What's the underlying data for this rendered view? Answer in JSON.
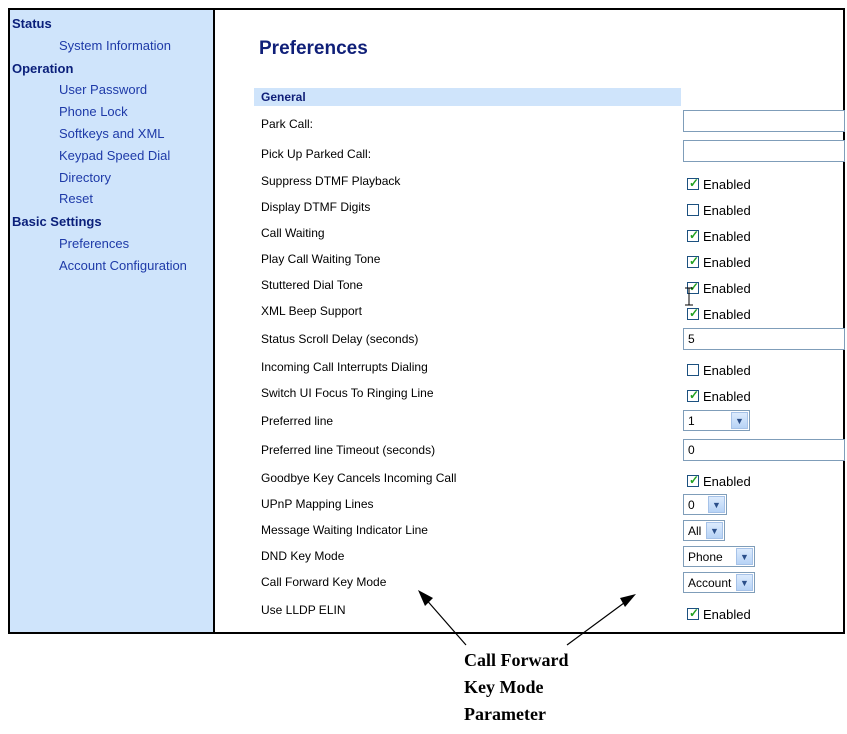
{
  "sidebar": {
    "sections": [
      {
        "title": "Status",
        "items": [
          "System Information"
        ]
      },
      {
        "title": "Operation",
        "items": [
          "User Password",
          "Phone Lock",
          "Softkeys and XML",
          "Keypad Speed Dial",
          "Directory",
          "Reset"
        ]
      },
      {
        "title": "Basic Settings",
        "items": [
          "Preferences",
          "Account Configuration"
        ]
      }
    ]
  },
  "page": {
    "title": "Preferences",
    "section_header": "General"
  },
  "rows": [
    {
      "label": "Park Call:",
      "control": "text",
      "value": ""
    },
    {
      "label": "Pick Up Parked Call:",
      "control": "text",
      "value": ""
    },
    {
      "label": "Suppress DTMF Playback",
      "control": "checkbox",
      "checked": true,
      "text": "Enabled"
    },
    {
      "label": "Display DTMF Digits",
      "control": "checkbox",
      "checked": false,
      "text": "Enabled"
    },
    {
      "label": "Call Waiting",
      "control": "checkbox",
      "checked": true,
      "text": "Enabled"
    },
    {
      "label": "Play Call Waiting Tone",
      "control": "checkbox",
      "checked": true,
      "text": "Enabled"
    },
    {
      "label": "Stuttered Dial Tone",
      "control": "checkbox",
      "checked": true,
      "text": "Enabled"
    },
    {
      "label": "XML Beep Support",
      "control": "checkbox",
      "checked": true,
      "text": "Enabled"
    },
    {
      "label": "Status Scroll Delay (seconds)",
      "control": "text",
      "value": "5"
    },
    {
      "label": "Incoming Call Interrupts Dialing",
      "control": "checkbox",
      "checked": false,
      "text": "Enabled"
    },
    {
      "label": "Switch UI Focus To Ringing Line",
      "control": "checkbox",
      "checked": true,
      "text": "Enabled"
    },
    {
      "label": "Preferred line",
      "control": "select",
      "value": "1"
    },
    {
      "label": "Preferred line Timeout (seconds)",
      "control": "text",
      "value": "0"
    },
    {
      "label": "Goodbye Key Cancels Incoming Call",
      "control": "checkbox",
      "checked": true,
      "text": "Enabled"
    },
    {
      "label": "UPnP Mapping Lines",
      "control": "select",
      "value": "0"
    },
    {
      "label": "Message Waiting Indicator Line",
      "control": "select",
      "value": "All"
    },
    {
      "label": "DND Key Mode",
      "control": "select",
      "value": "Phone"
    },
    {
      "label": "Call Forward Key Mode",
      "control": "select",
      "value": "Account"
    },
    {
      "label": "Use LLDP ELIN",
      "control": "checkbox",
      "checked": true,
      "text": "Enabled"
    }
  ],
  "annotation": {
    "lines": [
      "Call Forward",
      "Key Mode",
      "Parameter"
    ]
  }
}
